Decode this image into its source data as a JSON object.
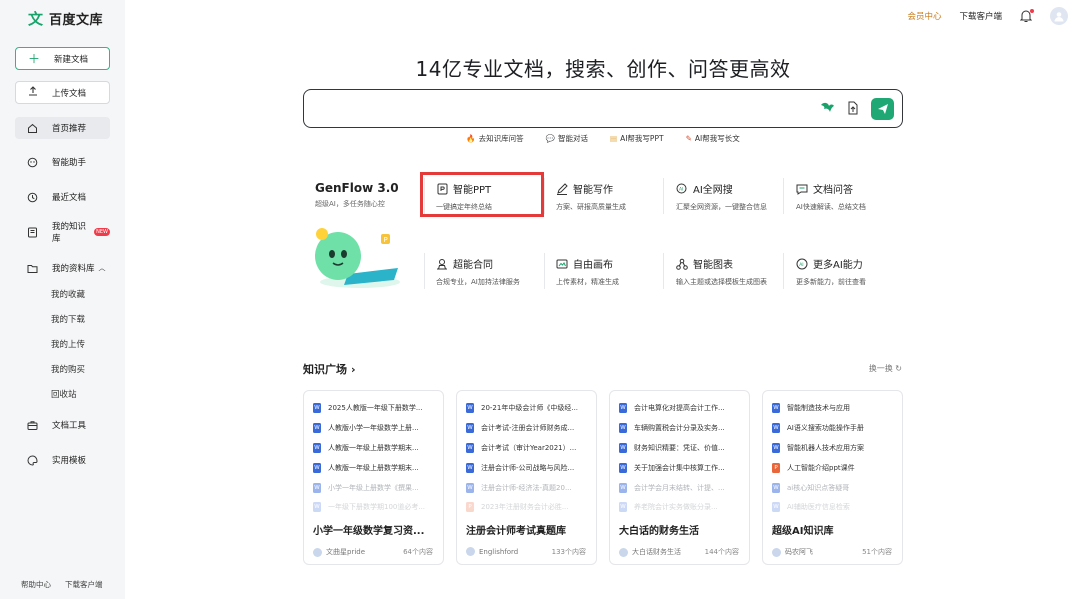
{
  "brand": {
    "mark": "文",
    "name": "百度文库"
  },
  "sidebar": {
    "new_doc": "新建文档",
    "upload_doc": "上传文档",
    "nav": {
      "home": "首页推荐",
      "assistant": "智能助手",
      "recent": "最近文档",
      "knowledge": "我的知识库",
      "knowledge_badge": "NEW",
      "library": "我的资料库",
      "tools": "文档工具",
      "templates": "实用模板"
    },
    "library_items": [
      "我的收藏",
      "我的下载",
      "我的上传",
      "我的购买",
      "回收站"
    ],
    "footer": {
      "help": "帮助中心",
      "download": "下载客户端"
    }
  },
  "header": {
    "vip": "会员中心",
    "download_client": "下载客户端"
  },
  "main": {
    "headline": "14亿专业文档，搜索、创作、问答更高效",
    "search_placeholder": "",
    "quick_links": [
      "去知识库问答",
      "智能对话",
      "AI帮我写PPT",
      "AI帮我写长文"
    ],
    "genflow": {
      "title": "GenFlow 3.0",
      "subtitle": "超级AI，多任务随心控"
    },
    "features": [
      {
        "title": "智能PPT",
        "desc": "一键搞定年终总结"
      },
      {
        "title": "智能写作",
        "desc": "方案、研报高质量生成"
      },
      {
        "title": "AI全网搜",
        "desc": "汇聚全网资源，一键整合信息"
      },
      {
        "title": "文档问答",
        "desc": "AI快速解读、总结文档"
      },
      {
        "title": "超能合同",
        "desc": "合规专业，AI加持法律服务"
      },
      {
        "title": "自由画布",
        "desc": "上传素材，精准生成"
      },
      {
        "title": "智能图表",
        "desc": "输入主题或选择模板生成图表"
      },
      {
        "title": "更多AI能力",
        "desc": "更多新能力，前往查看"
      }
    ]
  },
  "knowledge_square": {
    "title": "知识广场",
    "refresh": "换一换",
    "cards": [
      {
        "items": [
          "2025人教版一年级下册数学...",
          "人教版小学一年级数学上册...",
          "人教版一年级上册数学期末...",
          "人教版一年级上册数学期末...",
          "小学一年级上册数学《撰果...",
          "一年级下册数学期100道必考..."
        ],
        "name": "小学一年级数学复习资...",
        "author": "文曲星pride",
        "count": "64个内容"
      },
      {
        "items": [
          "20-21年中级会计师《中级经...",
          "会计考试-注册会计师财务成...",
          "会计考试（审计Year2021）...",
          "注册会计师-公司战略与风险...",
          "注册会计师-经济法-真题20...",
          "2023年注册财务会计必胜..."
        ],
        "name": "注册会计师考试真题库",
        "author": "Englishford",
        "count": "133个内容"
      },
      {
        "items": [
          "会计电算化对提高会计工作...",
          "车辆购置税会计分录及实务...",
          "财务知识精要：凭证、价值...",
          "关于加强会计集中核算工作...",
          "会计学会月末结转、计提、...",
          "养老院会计实务做账分录..."
        ],
        "name": "大白话的财务生活",
        "author": "大白话财务生活",
        "count": "144个内容"
      },
      {
        "items": [
          "智能制造技术与应用",
          "AI语义搜索功能操作手册",
          "智能机器人技术应用方案",
          "人工智能介绍ppt课件",
          "ai核心知识点答疑哥",
          "AI辅助医疗信息检索"
        ],
        "name": "超级AI知识库",
        "author": "码农阿飞",
        "count": "51个内容"
      }
    ]
  },
  "colors": {
    "brand_green": "#1fa873",
    "vip_orange": "#c97c1a",
    "highlight_red": "#e53a3a"
  }
}
